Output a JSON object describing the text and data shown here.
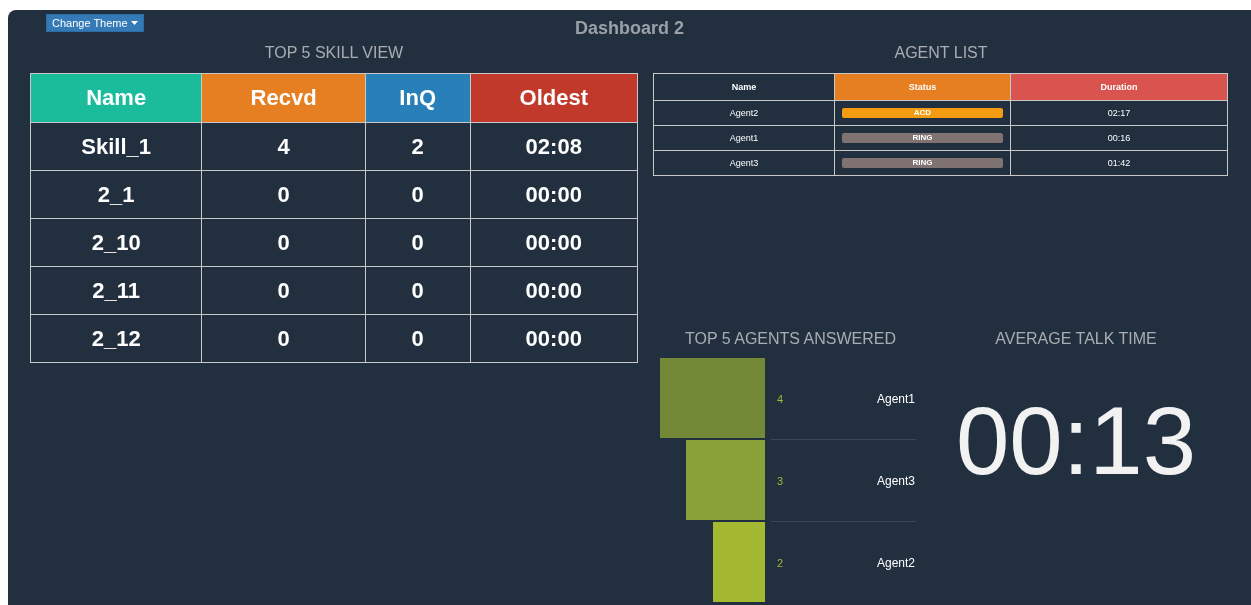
{
  "title": "Dashboard 2",
  "theme_button": {
    "label": "Change Theme"
  },
  "skill_view": {
    "title": "TOP 5 SKILL VIEW",
    "columns": [
      {
        "label": "Name",
        "color": "#1abc9c"
      },
      {
        "label": "Recvd",
        "color": "#e67e22"
      },
      {
        "label": "InQ",
        "color": "#2980b9"
      },
      {
        "label": "Oldest",
        "color": "#c0392b"
      }
    ],
    "rows": [
      [
        "Skill_1",
        "4",
        "2",
        "02:08"
      ],
      [
        "2_1",
        "0",
        "0",
        "00:00"
      ],
      [
        "2_10",
        "0",
        "0",
        "00:00"
      ],
      [
        "2_11",
        "0",
        "0",
        "00:00"
      ],
      [
        "2_12",
        "0",
        "0",
        "00:00"
      ]
    ]
  },
  "agent_list": {
    "title": "AGENT LIST",
    "columns": [
      {
        "label": "Name",
        "color": "#212f3f"
      },
      {
        "label": "Status",
        "color": "#e67e22"
      },
      {
        "label": "Duration",
        "color": "#d9534f"
      }
    ],
    "rows": [
      {
        "name": "Agent2",
        "status": "ACD",
        "color": "#f39c12",
        "duration": "02:17"
      },
      {
        "name": "Agent1",
        "status": "RING",
        "color": "#7f7270",
        "duration": "00:16"
      },
      {
        "name": "Agent3",
        "status": "RING",
        "color": "#7f7270",
        "duration": "01:42"
      }
    ]
  },
  "agents_answered": {
    "title": "TOP 5 AGENTS ANSWERED",
    "chart_data": {
      "type": "bar",
      "orientation": "horizontal",
      "categories": [
        "Agent1",
        "Agent3",
        "Agent2"
      ],
      "values": [
        4,
        3,
        2
      ],
      "data_labels": true
    }
  },
  "talk_time": {
    "title": "AVERAGE TALK TIME",
    "value": "00:13"
  }
}
